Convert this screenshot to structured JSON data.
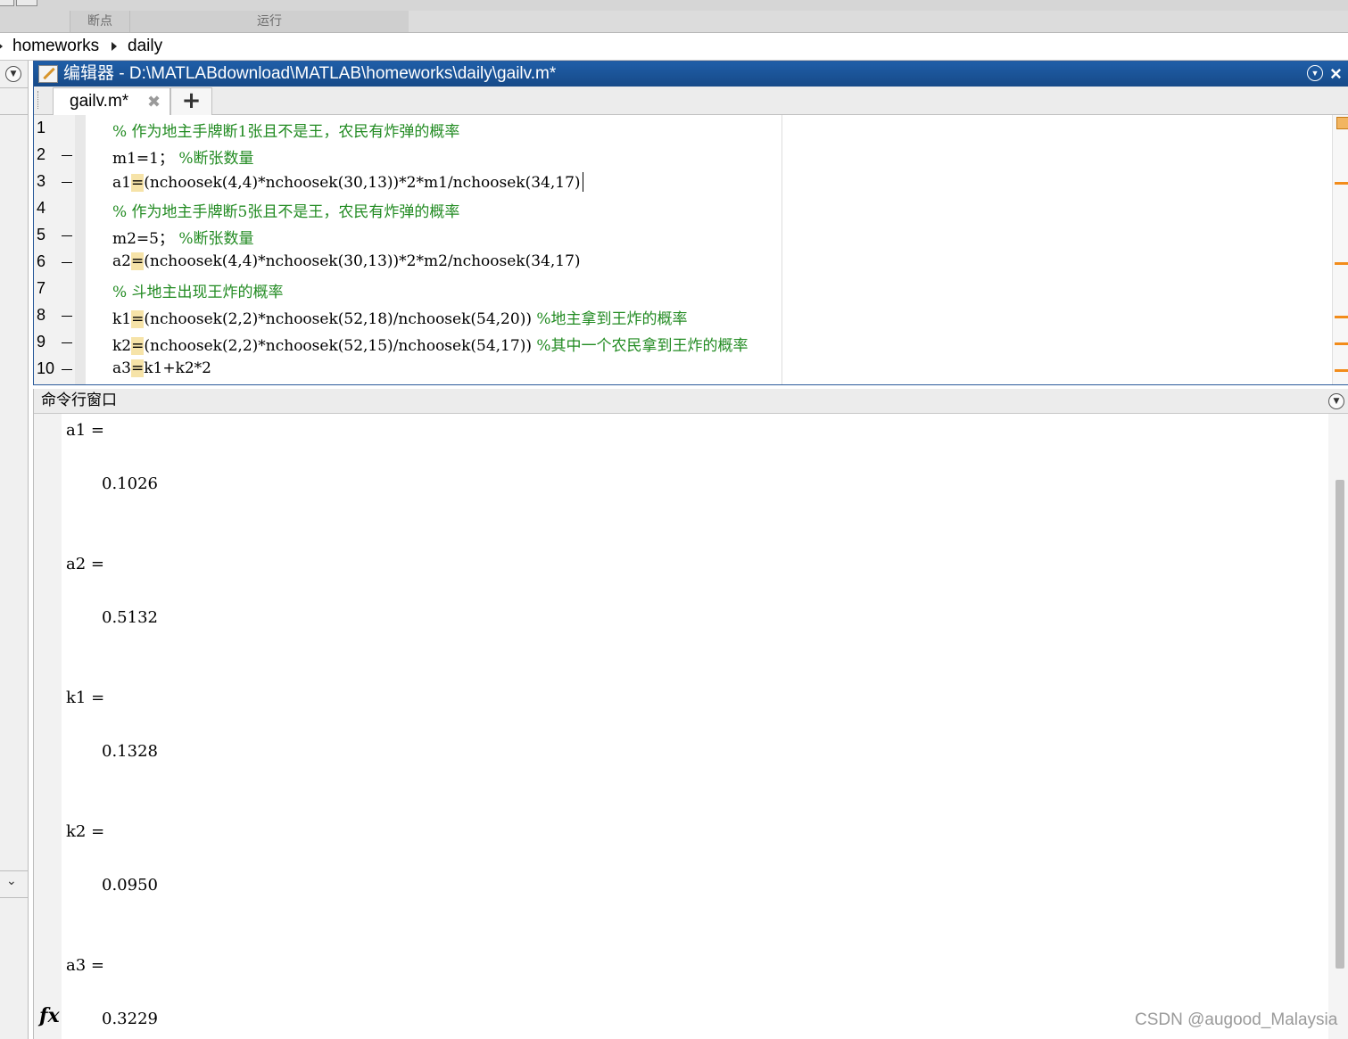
{
  "toolstrip": {
    "sections": [
      "断点",
      "运行"
    ]
  },
  "address": {
    "crumbs": [
      "homeworks",
      "daily"
    ]
  },
  "editor": {
    "app_label": "编辑器",
    "file_path": "D:\\MATLABdownload\\MATLAB\\homeworks\\daily\\gailv.m*",
    "title": "编辑器 - D:\\MATLABdownload\\MATLAB\\homeworks\\daily\\gailv.m*",
    "minimize_icon": "chevron-down-circle-icon",
    "close_label": "×",
    "tab": {
      "label": "gailv.m*",
      "close_label": "✖"
    },
    "add_tab_label": "+",
    "lines": [
      {
        "n": "1",
        "code": "",
        "eq": "",
        "rest": "",
        "comment": "% 作为地主手牌断1张且不是王，农民有炸弹的概率"
      },
      {
        "n": "2",
        "code": "m1=1；",
        "eq": "",
        "rest": "",
        "comment": " %断张数量"
      },
      {
        "n": "3",
        "code": "a1",
        "eq": "=",
        "rest": "(nchoosek(4,4)*nchoosek(30,13))*2*m1/nchoosek(34,17)",
        "comment": ""
      },
      {
        "n": "4",
        "code": "",
        "eq": "",
        "rest": "",
        "comment": "% 作为地主手牌断5张且不是王，农民有炸弹的概率"
      },
      {
        "n": "5",
        "code": "m2=5；",
        "eq": "",
        "rest": "",
        "comment": " %断张数量"
      },
      {
        "n": "6",
        "code": "a2",
        "eq": "=",
        "rest": "(nchoosek(4,4)*nchoosek(30,13))*2*m2/nchoosek(34,17)",
        "comment": ""
      },
      {
        "n": "7",
        "code": "",
        "eq": "",
        "rest": "",
        "comment": "% 斗地主出现王炸的概率"
      },
      {
        "n": "8",
        "code": "k1",
        "eq": "=",
        "rest": "(nchoosek(2,2)*nchoosek(52,18)/nchoosek(54,20))",
        "comment": " %地主拿到王炸的概率"
      },
      {
        "n": "9",
        "code": "k2",
        "eq": "=",
        "rest": "(nchoosek(2,2)*nchoosek(52,15)/nchoosek(54,17))",
        "comment": " %其中一个农民拿到王炸的概率"
      },
      {
        "n": "10",
        "code": "a3",
        "eq": "=",
        "rest": "k1+k2*2",
        "comment": ""
      }
    ]
  },
  "command_window": {
    "title": "命令行窗口",
    "outputs": [
      {
        "var": "a1 =",
        "value": "0.1026"
      },
      {
        "var": "a2 =",
        "value": "0.5132"
      },
      {
        "var": "k1 =",
        "value": "0.1328"
      },
      {
        "var": "k2 =",
        "value": "0.0950"
      },
      {
        "var": "a3 =",
        "value": "0.3229"
      }
    ],
    "prompt_label": "fx"
  },
  "watermark": "CSDN @augood_Malaysia",
  "colors": {
    "editor_title_bg": "#1f5ea8",
    "comment_green": "#228b22",
    "warning_orange": "#f28c1b",
    "equals_highlight": "#f6e3a8"
  }
}
